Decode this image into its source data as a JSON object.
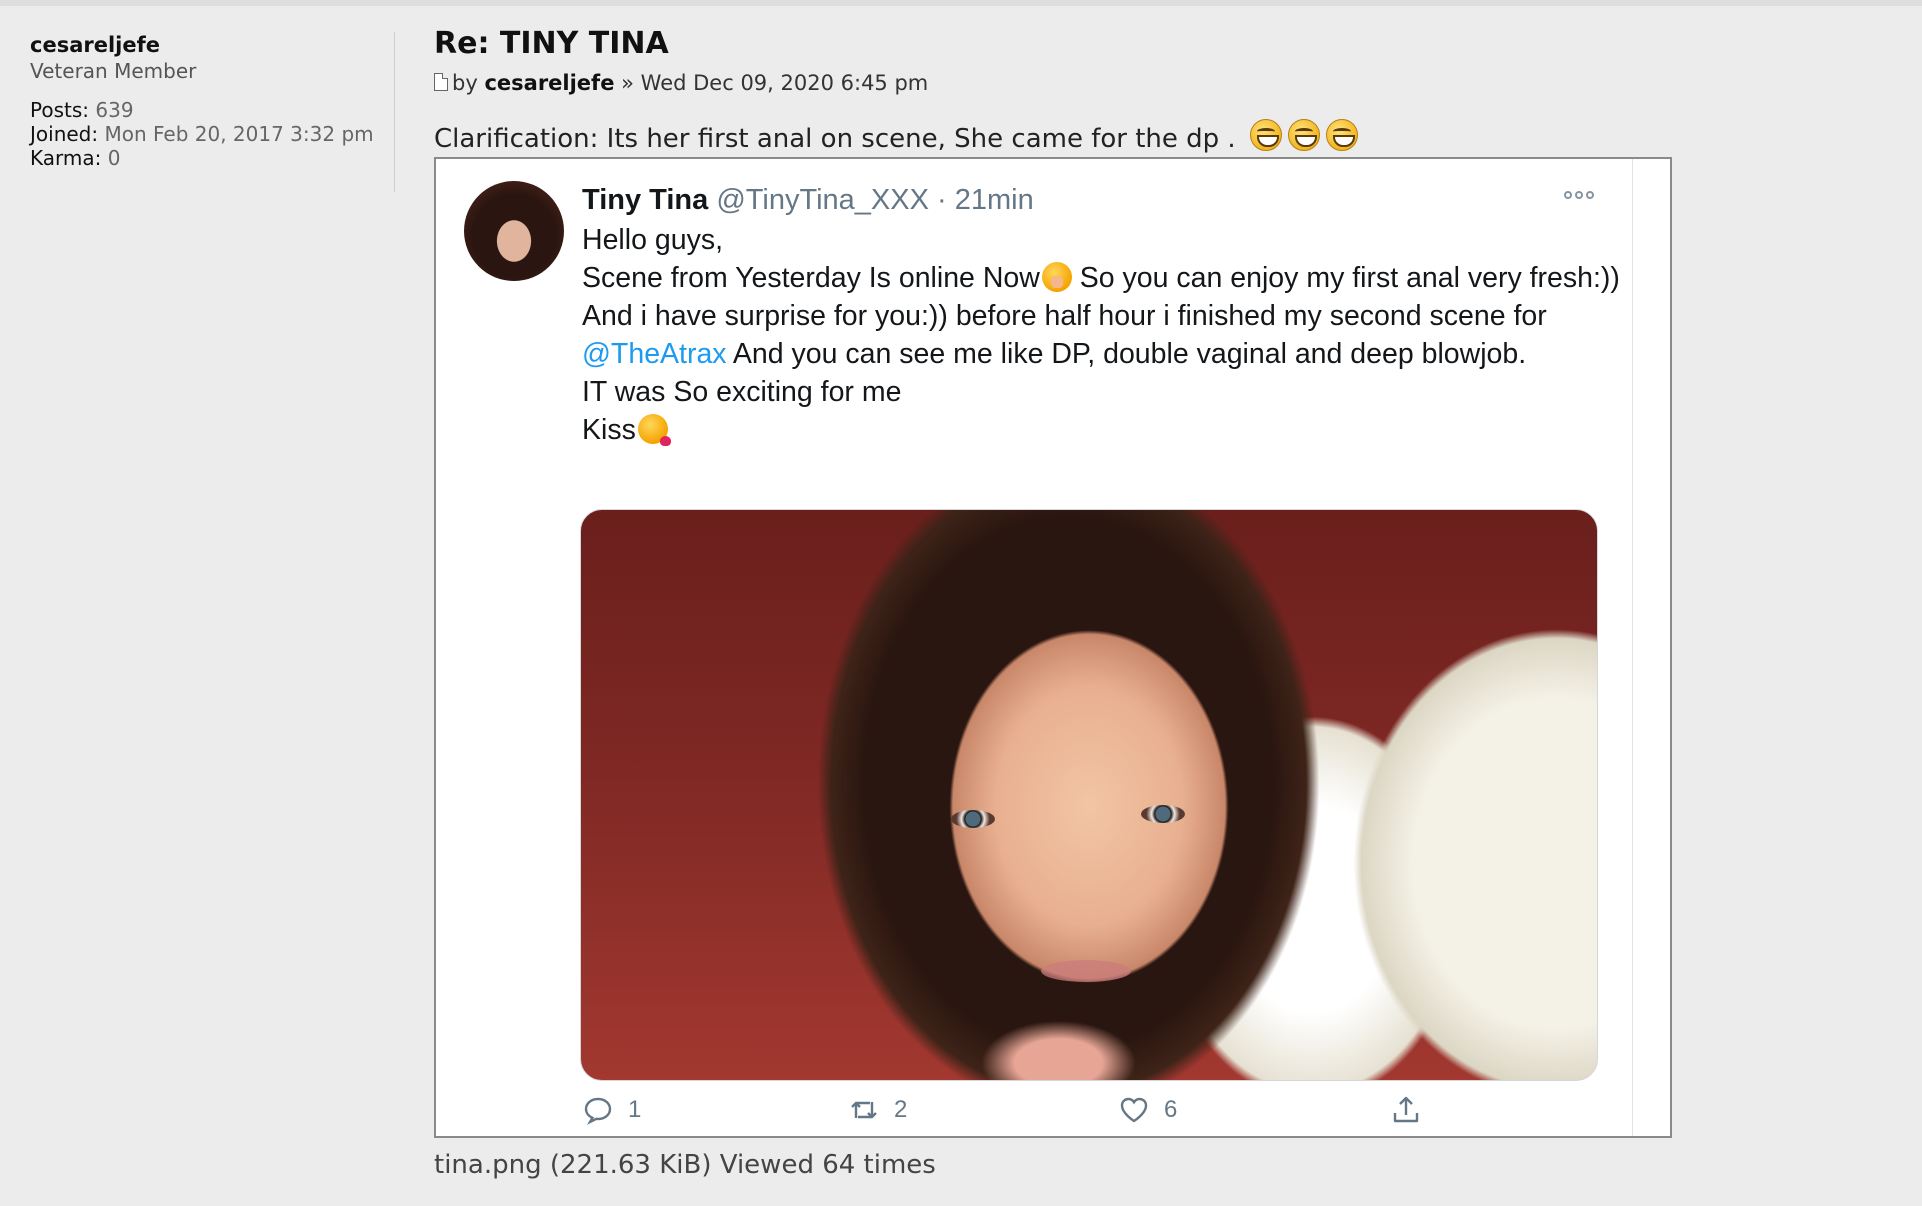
{
  "profile": {
    "username": "cesareljefe",
    "rank": "Veteran Member",
    "posts_label": "Posts:",
    "posts_value": "639",
    "joined_label": "Joined:",
    "joined_value": "Mon Feb 20, 2017 3:32 pm",
    "karma_label": "Karma:",
    "karma_value": "0"
  },
  "post": {
    "title": "Re: TINY TINA",
    "by_label": "by",
    "author": "cesareljefe",
    "separator": "»",
    "date": "Wed Dec 09, 2020 6:45 pm",
    "text": "Clarification: Its her first anal on scene, She came for the dp .",
    "smilies": [
      "grin-icon",
      "grin-icon",
      "grin-icon"
    ]
  },
  "tweet": {
    "name": "Tiny Tina",
    "handle": "@TinyTina_XXX",
    "dot": "·",
    "time": "21min",
    "lines": {
      "l1": "Hello guys,",
      "l2a": "Scene from Yesterday Is online Now",
      "l2b": " So you can enjoy my first anal very fresh:))",
      "l3": "And i have surprise for you:)) before half hour i finished my second scene for",
      "mention": "@TheAtrax",
      "l4": " And you can see me like DP, double vaginal and deep blowjob.",
      "l5": "IT was So exciting for me",
      "l6": "Kiss"
    },
    "replies": "1",
    "retweets": "2",
    "likes": "6"
  },
  "attachment": {
    "caption": "tina.png (221.63 KiB) Viewed 64 times"
  },
  "colors": {
    "page_bg": "#ececec",
    "link_blue": "#1d9bf0",
    "tweet_gray": "#657786"
  }
}
